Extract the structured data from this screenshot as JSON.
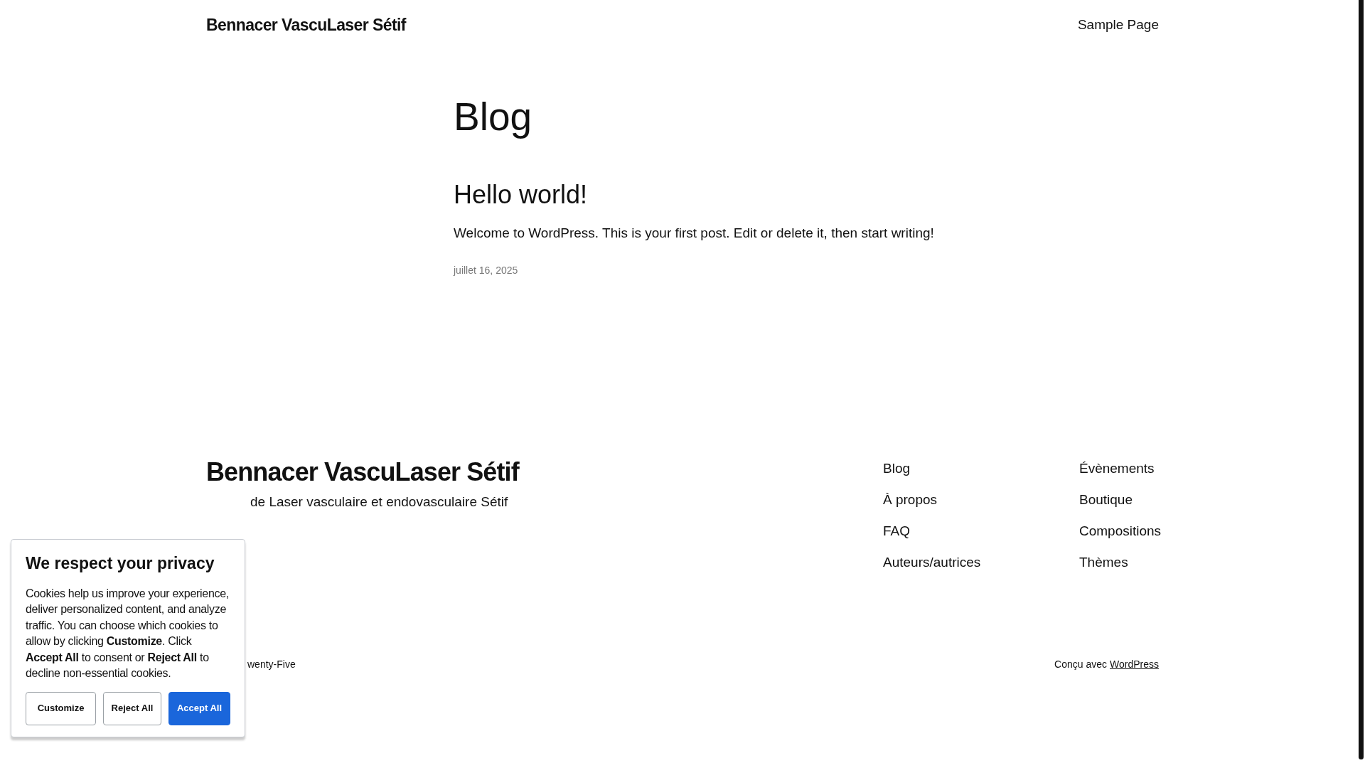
{
  "header": {
    "site_title": "Bennacer VascuLaser Sétif",
    "nav": [
      "Sample Page"
    ]
  },
  "page_title": "Blog",
  "posts": [
    {
      "title": "Hello world!",
      "excerpt": "Welcome to WordPress. This is your first post. Edit or delete it, then start writing!",
      "date": "juillet 16, 2025"
    }
  ],
  "footer": {
    "site_title": "Bennacer VascuLaser Sétif",
    "tagline": "de Laser vasculaire et endovasculaire Sétif",
    "nav_columns": [
      [
        "Blog",
        "À propos",
        "FAQ",
        "Auteurs/autrices"
      ],
      [
        "Évènements",
        "Boutique",
        "Compositions",
        "Thèmes"
      ]
    ],
    "theme_credit": "wenty-Five",
    "credit_text": "Conçu avec",
    "credit_link": "WordPress"
  },
  "cookie_banner": {
    "title": "We respect your privacy",
    "text": "Cookies help us improve your experience, deliver personalized content, and analyze traffic. You can choose which cookies to allow by clicking **Customize**. Click **Accept All** to consent or **Reject All** to decline non-essential cookies.",
    "buttons": [
      {
        "label": "Customize",
        "kind": "outline"
      },
      {
        "label": "Reject All",
        "kind": "outline"
      },
      {
        "label": "Accept All",
        "kind": "primary"
      }
    ]
  }
}
